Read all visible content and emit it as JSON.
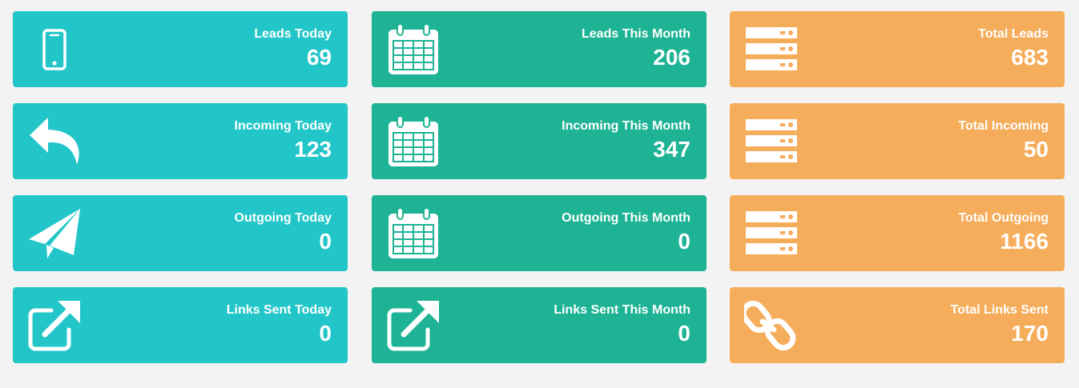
{
  "colors": {
    "today": "#22c6c9",
    "month": "#1db394",
    "total": "#f6ad5b",
    "background": "#f3f3f3"
  },
  "tiles": [
    {
      "label": "Leads Today",
      "value": "69",
      "icon": "mobile-phone-icon"
    },
    {
      "label": "Leads This Month",
      "value": "206",
      "icon": "calendar-icon"
    },
    {
      "label": "Total Leads",
      "value": "683",
      "icon": "server-icon"
    },
    {
      "label": "Incoming Today",
      "value": "123",
      "icon": "reply-arrow-icon"
    },
    {
      "label": "Incoming This Month",
      "value": "347",
      "icon": "calendar-icon"
    },
    {
      "label": "Total Incoming",
      "value": "50",
      "icon": "server-icon"
    },
    {
      "label": "Outgoing Today",
      "value": "0",
      "icon": "paper-plane-icon"
    },
    {
      "label": "Outgoing This Month",
      "value": "0",
      "icon": "calendar-icon"
    },
    {
      "label": "Total Outgoing",
      "value": "1166",
      "icon": "server-icon"
    },
    {
      "label": "Links Sent Today",
      "value": "0",
      "icon": "external-link-icon"
    },
    {
      "label": "Links Sent This Month",
      "value": "0",
      "icon": "external-link-icon"
    },
    {
      "label": "Total Links Sent",
      "value": "170",
      "icon": "chain-link-icon"
    }
  ]
}
